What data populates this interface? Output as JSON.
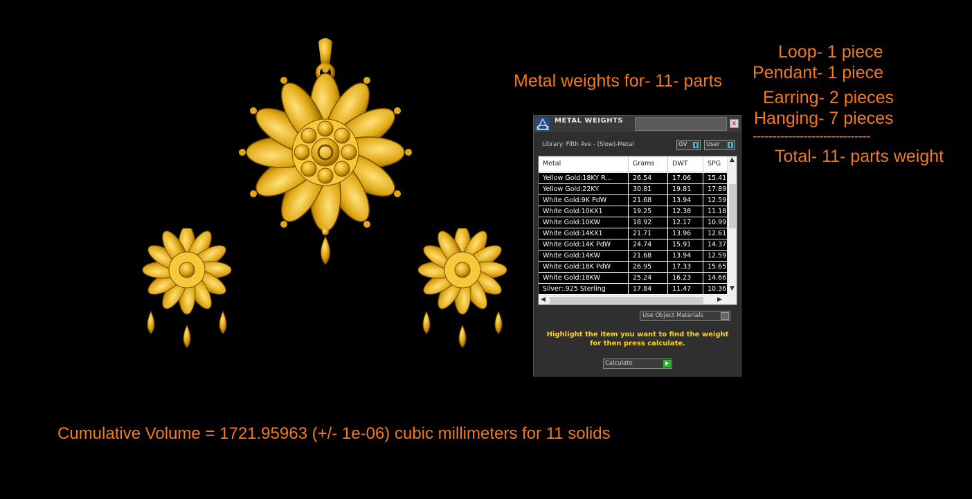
{
  "annotations": {
    "metal_weights_title": "Metal weights for- 11- parts",
    "loop": "Loop- 1 piece",
    "pendant": "Pendant- 1 piece",
    "earring": "Earring- 2 pieces",
    "hanging": "Hanging- 7 pieces",
    "separator": "------------------------------",
    "total": "Total- 11- parts weight",
    "cumulative": "Cumulative Volume = 1721.95963 (+/- 1e-06) cubic millimeters for 11 solids"
  },
  "dialog": {
    "title": "METAL WEIGHTS",
    "close": "x",
    "library": "Library: Fifth Ave - (Slow)-Metal",
    "toggle_gv": "GV",
    "toggle_user": "User",
    "columns": [
      "Metal",
      "Grams",
      "DWT",
      "SPG"
    ],
    "rows": [
      [
        "Yellow Gold:18KY R...",
        "26.54",
        "17.06",
        "15.41"
      ],
      [
        "Yellow Gold:22KY",
        "30.81",
        "19.81",
        "17.89"
      ],
      [
        "White Gold:9K PdW",
        "21.68",
        "13.94",
        "12.59"
      ],
      [
        "White Gold:10KX1",
        "19.25",
        "12.38",
        "11.18"
      ],
      [
        "White Gold:10KW",
        "18.92",
        "12.17",
        "10.99"
      ],
      [
        "White Gold:14KX1",
        "21.71",
        "13.96",
        "12.61"
      ],
      [
        "White Gold:14K PdW",
        "24.74",
        "15.91",
        "14.37"
      ],
      [
        "White Gold:14KW",
        "21.68",
        "13.94",
        "12.59"
      ],
      [
        "White Gold:18K PdW",
        "26.95",
        "17.33",
        "15.65"
      ],
      [
        "White Gold:18KW",
        "25.24",
        "16.23",
        "14.66"
      ],
      [
        "Silver:.925 Sterling",
        "17.84",
        "11.47",
        "10.36"
      ]
    ],
    "use_object_materials": "Use Object Materials",
    "hint": "Highlight the item you want to find the weight for then press calculate.",
    "calculate": "Calculate"
  },
  "colors": {
    "accent": "#f07a1e",
    "gold": "#d4a017",
    "hint": "#ffd21f"
  }
}
